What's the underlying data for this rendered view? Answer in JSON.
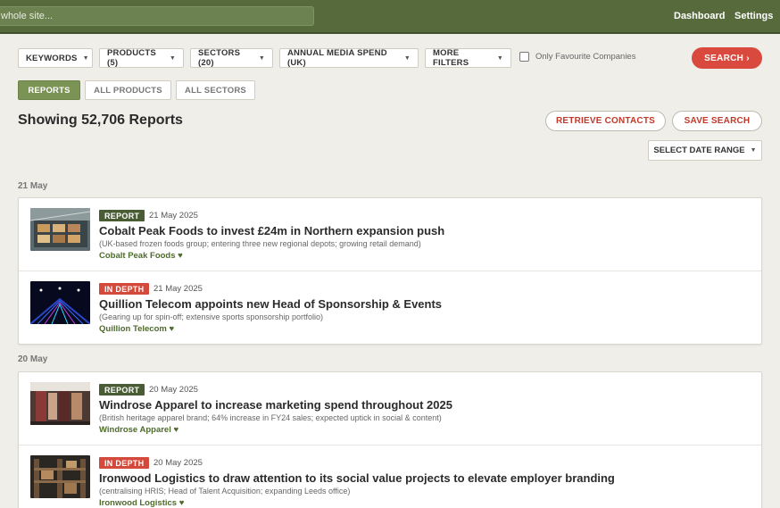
{
  "topbar": {
    "search_placeholder": "whole site...",
    "links": [
      "Dashboard",
      "Settings"
    ]
  },
  "filters": {
    "buttons": [
      "KEYWORDS",
      "PRODUCTS (5)",
      "SECTORS (20)",
      "ANNUAL MEDIA SPEND (UK)",
      "MORE FILTERS"
    ],
    "favourite_label": "Only Favourite Companies",
    "favourite_checked": false,
    "search_label": "SEARCH ›"
  },
  "tabs": [
    "REPORTS",
    "ALL PRODUCTS",
    "ALL SECTORS"
  ],
  "results": {
    "heading": "Showing 52,706 Reports",
    "retrieve_label": "RETRIEVE CONTACTS",
    "save_label": "SAVE SEARCH",
    "date_range_label": "SELECT DATE RANGE"
  },
  "groups": [
    {
      "date": "21 May",
      "items": [
        {
          "badge": "REPORT",
          "date": "21 May 2025",
          "title": "Cobalt Peak Foods to invest £24m in Northern expansion push",
          "desc": "(UK-based frozen foods group; entering three new regional depots; growing retail demand)",
          "company": "Cobalt Peak Foods ♥"
        },
        {
          "badge": "IN DEPTH",
          "date": "21 May 2025",
          "title": "Quillion Telecom appoints new Head of Sponsorship & Events",
          "desc": "(Gearing up for spin-off; extensive sports sponsorship portfolio)",
          "company": "Quillion Telecom ♥"
        }
      ]
    },
    {
      "date": "20 May",
      "items": [
        {
          "badge": "REPORT",
          "date": "20 May 2025",
          "title": "Windrose Apparel to increase marketing spend throughout 2025",
          "desc": "(British heritage apparel brand; 64% increase in FY24 sales; expected uptick in social & content)",
          "company": "Windrose Apparel ♥"
        },
        {
          "badge": "IN DEPTH",
          "date": "20 May 2025",
          "title": "Ironwood Logistics to draw attention to its social value projects to elevate employer branding",
          "desc": "(centralising HRIS; Head of Talent Acquisition; expanding Leeds office)",
          "company": "Ironwood Logistics ♥"
        }
      ]
    }
  ],
  "colors": {
    "topbar": "#566a3c",
    "accent_green": "#7c9356",
    "report_badge": "#4a5c34",
    "indepth_badge": "#d34a3c",
    "search_button": "#d9493d"
  }
}
